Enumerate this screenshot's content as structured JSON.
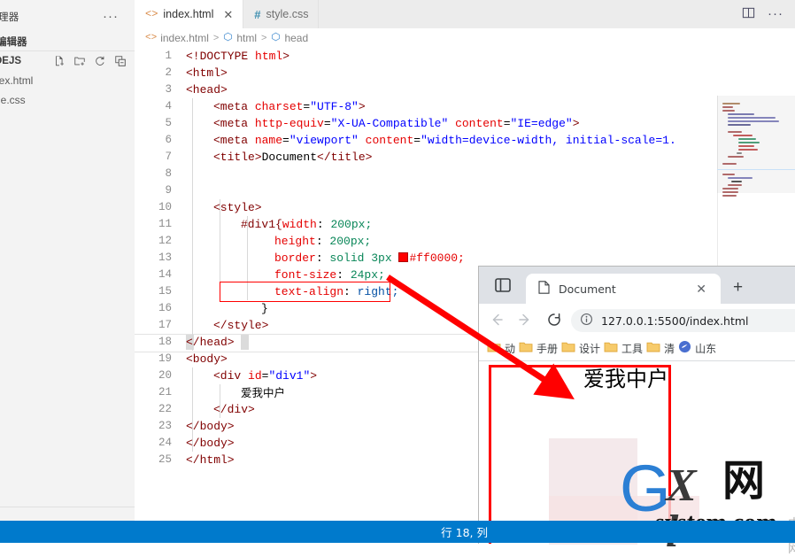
{
  "sidebar": {
    "title": "理器",
    "more_label": "···",
    "section_label": "编辑器",
    "folder_name": "DEJS",
    "actions": [
      {
        "name": "new-file-icon",
        "label": "新建文件"
      },
      {
        "name": "new-folder-icon",
        "label": "新建文件夹"
      },
      {
        "name": "refresh-icon",
        "label": "刷新"
      },
      {
        "name": "collapse-icon",
        "label": "折叠"
      }
    ],
    "files": [
      {
        "label": "dex.html"
      },
      {
        "label": "yle.css"
      }
    ]
  },
  "editor": {
    "tabs": [
      {
        "label": "index.html",
        "icon": "<>",
        "active": true,
        "close": "✕"
      },
      {
        "label": "style.css",
        "icon": "#",
        "active": false,
        "close": ""
      }
    ],
    "tab_actions": [
      {
        "name": "split-editor-icon"
      },
      {
        "name": "more-actions-icon",
        "label": "···"
      }
    ],
    "breadcrumb": {
      "file_icon": "<>",
      "file": "index.html",
      "sep": ">",
      "nodes": [
        "html",
        "head"
      ]
    },
    "line_numbers": [
      1,
      2,
      3,
      4,
      5,
      6,
      7,
      8,
      9,
      10,
      11,
      12,
      13,
      14,
      15,
      16,
      17,
      18,
      19,
      20,
      21,
      22,
      23,
      24,
      25
    ],
    "code": {
      "l1_a": "<!DOCTYPE ",
      "l1_b": "html",
      "l1_c": ">",
      "l2": "<html>",
      "l3": "<head>",
      "l4_tag": "<meta ",
      "l4_attr": "charset",
      "l4_eq": "=",
      "l4_val": "\"UTF-8\"",
      "l4_end": ">",
      "l5_tag": "<meta ",
      "l5_attr": "http-equiv",
      "l5_val": "\"X-UA-Compatible\"",
      "l5_attr2": "content",
      "l5_val2": "\"IE=edge\"",
      "l5_end": ">",
      "l6_tag": "<meta ",
      "l6_attr": "name",
      "l6_val": "\"viewport\"",
      "l6_attr2": "content",
      "l6_val2": "\"width=device-width, initial-scale=1.",
      "l7_a": "<title>",
      "l7_b": "Document",
      "l7_c": "</title>",
      "l9": "<style>",
      "l10_sel": "#div1{",
      "l10_prop": "width",
      "l10_val": "200px;",
      "l11_prop": "height",
      "l11_val": "200px;",
      "l12_prop": "border",
      "l12_val": "solid 3px ",
      "l12_color": "#ff0000;",
      "l13_prop": "font-size",
      "l13_val": "24px;",
      "l14_prop": "text-align",
      "l14_val": "right;",
      "l15": "}",
      "l16": "</style>",
      "l18": "</head>",
      "l19": "<body>",
      "l20_tag": "<div ",
      "l20_attr": "id",
      "l20_val": "\"div1\"",
      "l20_end": ">",
      "l21_text": "爱我中户",
      "l22": "</div>",
      "l23": "</body>",
      "l24": "</body>",
      "l25": "</html>"
    }
  },
  "status_bar": {
    "cursor_position": "行 18, 列"
  },
  "browser": {
    "tab_title": "Document",
    "tab_close": "✕",
    "new_tab": "+",
    "url": "127.0.0.1:5500/index.html",
    "nav": {
      "back": "back-icon",
      "forward": "forward-icon",
      "reload": "reload-icon",
      "info": "info-icon"
    },
    "bookmarks": [
      {
        "label": "动",
        "type": "folder"
      },
      {
        "label": "手册",
        "type": "folder"
      },
      {
        "label": "设计",
        "type": "folder"
      },
      {
        "label": "工具",
        "type": "folder"
      },
      {
        "label": "清",
        "type": "folder"
      },
      {
        "label": "山东",
        "type": "site"
      }
    ],
    "page": {
      "div_text": "爱我中户"
    }
  },
  "watermark": {
    "g": "G",
    "xl": "X l",
    "net": "网",
    "system": "system.com",
    "cn": "中文网"
  },
  "colors": {
    "accent_blue": "#007acc",
    "annotation_red": "#ff0000",
    "tabbar_bg": "#ececec",
    "sidebar_bg": "#f3f3f3",
    "browser_chrome": "#dee1e6"
  }
}
